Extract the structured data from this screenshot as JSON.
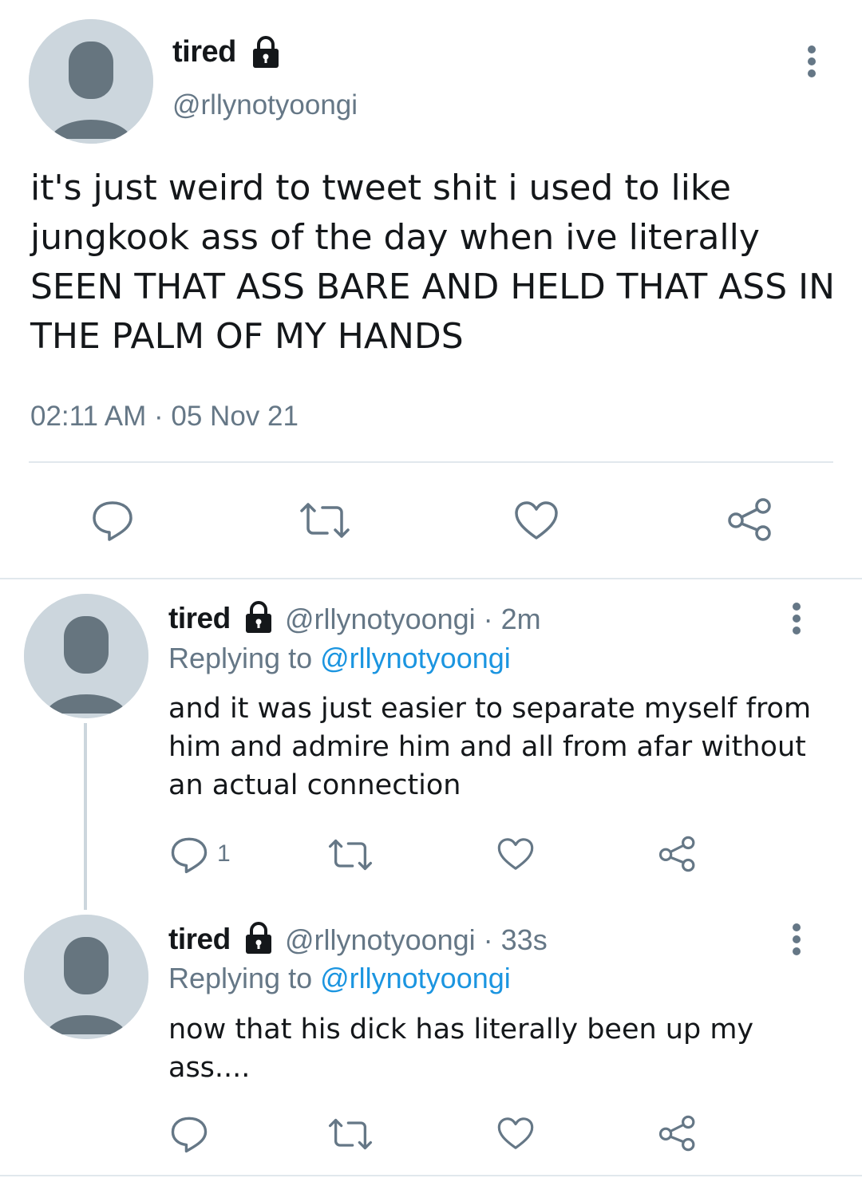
{
  "main": {
    "name": "tired",
    "handle": "@rllynotyoongi",
    "text": "it's just weird to tweet shit i used to like jungkook ass of the day when ive literally SEEN THAT ASS BARE AND HELD THAT ASS IN THE PALM OF MY HANDS",
    "timestamp": "02:11 AM · 05 Nov 21",
    "actions": [
      "comment-icon",
      "retweet-icon",
      "like-icon",
      "share-icon"
    ]
  },
  "replies": [
    {
      "name": "tired",
      "handle_time": "@rllynotyoongi · 2m",
      "replying_prefix": "Replying to ",
      "replying_to": "@rllynotyoongi",
      "text": "and it was just easier to separate myself from him and admire him and all from afar without an actual connection",
      "reply_count": "1"
    },
    {
      "name": "tired",
      "handle_time": "@rllynotyoongi · 33s",
      "replying_prefix": "Replying to ",
      "replying_to": "@rllynotyoongi",
      "text": "now that his dick has literally been up my ass....",
      "reply_count": ""
    }
  ],
  "colors": {
    "text": "#14171a",
    "secondary": "#657786",
    "link": "#1b95e0",
    "divider": "#e1e8ed",
    "avatar_bg": "#ccd6dd",
    "avatar_fg": "#66757f"
  }
}
